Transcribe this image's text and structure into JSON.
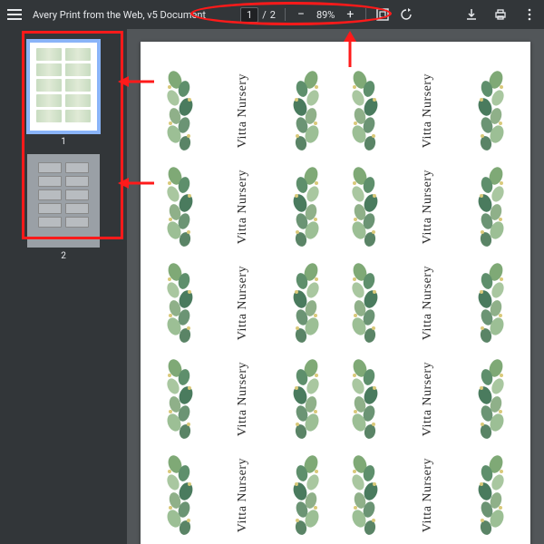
{
  "header": {
    "title": "Avery Print from the Web, v5 Document",
    "page_current": "1",
    "page_total": "2",
    "page_sep": "/",
    "zoom_minus": "−",
    "zoom_plus": "+",
    "zoom_value": "89%"
  },
  "sidebar": {
    "thumbs": [
      {
        "num": "1",
        "selected": true
      },
      {
        "num": "2",
        "selected": false
      }
    ]
  },
  "document": {
    "card_text": "Vitta Nursery",
    "cards_per_page": 10
  },
  "icons": {
    "fit": "fit-page-icon",
    "rotate": "rotate-icon",
    "download": "download-icon",
    "print": "print-icon",
    "more": "more-icon"
  }
}
